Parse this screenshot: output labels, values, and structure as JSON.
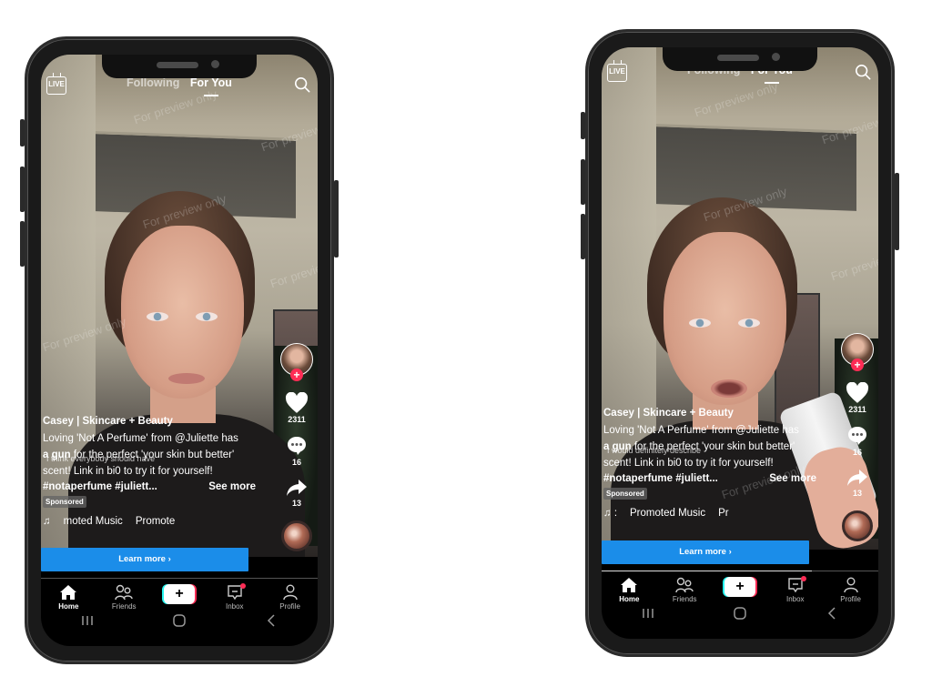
{
  "phones": [
    {
      "id": "left",
      "topbar": {
        "live_label": "LIVE",
        "tabs": [
          "Following",
          "For You"
        ],
        "active_tab": "For You"
      },
      "actions": {
        "likes": "2311",
        "comments": "16",
        "shares": "13"
      },
      "caption": {
        "author": "Casey | Skincare + Beauty",
        "line1": "Loving 'Not A Perfume' from @Juliette has",
        "line2_bold": "a gun",
        "line2_rest": " for the perfect 'your skin but better'",
        "line3": "scent! Link in bi0 to try it for yourself!",
        "subtitle_overlay": "I think everybody should have",
        "hashtags": "#notaperfume #juliett...",
        "see_more": "See more",
        "sponsored": "Sponsored",
        "music_note": "♫",
        "music_text": "moted Music",
        "music_extra": "Promote"
      },
      "cta": {
        "label": "Learn more ›"
      },
      "progress": 0.0,
      "watermark": "For preview only"
    },
    {
      "id": "right",
      "topbar": {
        "live_label": "LIVE",
        "tabs": [
          "Following",
          "For You"
        ],
        "active_tab": "For You"
      },
      "actions": {
        "likes": "2311",
        "comments": "16",
        "shares": "13"
      },
      "caption": {
        "author": "Casey | Skincare + Beauty",
        "line1": "Loving 'Not A Perfume' from @Juliette has",
        "line2_bold": "a gun",
        "line2_rest": " for the perfect 'your skin but better'",
        "line3": "scent! Link in bi0 to try it for yourself!",
        "subtitle_overlay": "I would definitely describe",
        "hashtags": "#notaperfume #juliett...",
        "see_more": "See more",
        "sponsored": "Sponsored",
        "music_note": "♫ :",
        "music_text": "Promoted Music",
        "music_extra": "Pr"
      },
      "cta": {
        "label": "Learn more ›"
      },
      "progress": 0.76,
      "watermark": "For preview only"
    }
  ],
  "navbar": {
    "items": [
      {
        "label": "Home",
        "icon": "home-icon",
        "active": true
      },
      {
        "label": "Friends",
        "icon": "friends-icon",
        "active": false
      },
      {
        "label": "+",
        "icon": "create-icon",
        "active": false
      },
      {
        "label": "Inbox",
        "icon": "inbox-icon",
        "active": false,
        "badge": true
      },
      {
        "label": "Profile",
        "icon": "profile-icon",
        "active": false
      }
    ]
  },
  "system_nav": {
    "recents": "|||",
    "home": "◯",
    "back": "‹"
  },
  "colors": {
    "accent_red": "#fe2c55",
    "cta_blue": "#1b8de9",
    "cyan": "#25f4ee"
  }
}
